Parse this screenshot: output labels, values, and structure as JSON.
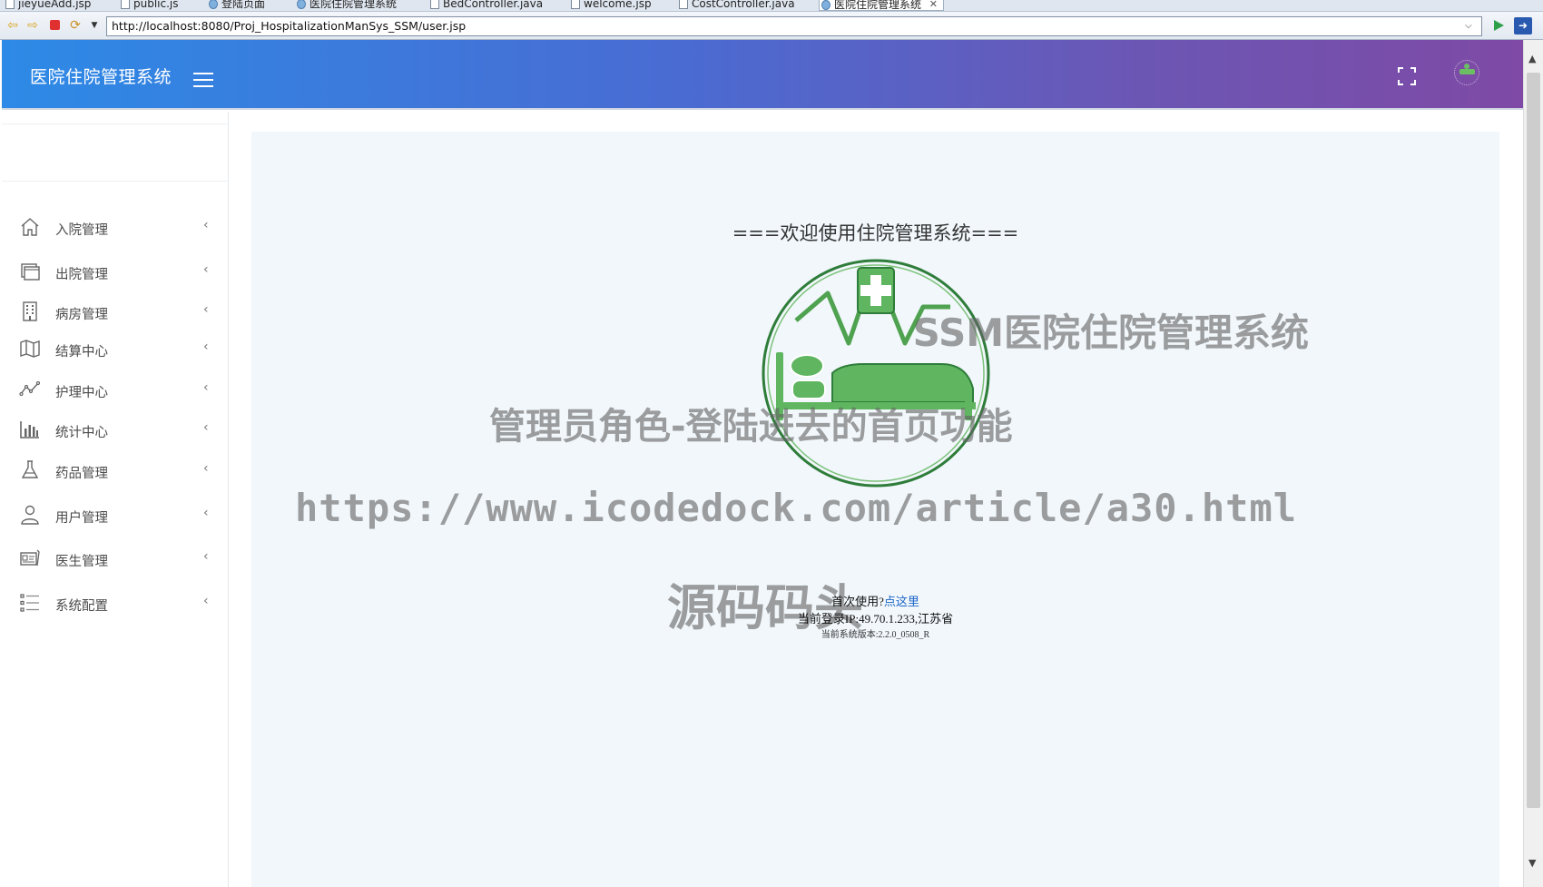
{
  "browser": {
    "tabs": [
      {
        "label": "jieyueAdd.jsp",
        "icon": "file-icon"
      },
      {
        "label": "public.js",
        "icon": "file-icon"
      },
      {
        "label": "登陆页面",
        "icon": "globe-icon"
      },
      {
        "label": "医院住院管理系统",
        "icon": "globe-icon"
      },
      {
        "label": "BedController.java",
        "icon": "file-icon"
      },
      {
        "label": "welcome.jsp",
        "icon": "file-icon"
      },
      {
        "label": "CostController.java",
        "icon": "file-icon"
      },
      {
        "label": "医院住院管理系统",
        "icon": "globe-icon",
        "active": true
      }
    ],
    "url": "http://localhost:8080/Proj_HospitalizationManSys_SSM/user.jsp"
  },
  "header": {
    "title": "医院住院管理系统"
  },
  "sidebar": {
    "items": [
      {
        "label": "入院管理",
        "icon": "home-icon"
      },
      {
        "label": "出院管理",
        "icon": "window-icon"
      },
      {
        "label": "病房管理",
        "icon": "building-icon"
      },
      {
        "label": "结算中心",
        "icon": "map-icon"
      },
      {
        "label": "护理中心",
        "icon": "line-chart-icon"
      },
      {
        "label": "统计中心",
        "icon": "bar-chart-icon"
      },
      {
        "label": "药品管理",
        "icon": "flask-icon"
      },
      {
        "label": "用户管理",
        "icon": "user-icon"
      },
      {
        "label": "医生管理",
        "icon": "id-card-icon"
      },
      {
        "label": "系统配置",
        "icon": "list-icon"
      }
    ]
  },
  "main": {
    "welcome": "===欢迎使用住院管理系统===",
    "first_use_prefix": "首次使用?",
    "first_use_link": "点这里",
    "login_ip": "当前登录IP:49.70.1.233,江苏省",
    "version": "当前系统版本:2.2.0_0508_R"
  },
  "watermark": {
    "line1": "SSM医院住院管理系统",
    "line2": "管理员角色-登陆进去的首页功能",
    "line3": "https://www.icodedock.com/article/a30.html",
    "line4": "源码码头"
  },
  "colors": {
    "header_start": "#2d8ae6",
    "header_end": "#7e4aa5",
    "logo_green": "#5fb560",
    "logo_ring": "#2f7d3a",
    "link": "#1a64c8"
  }
}
